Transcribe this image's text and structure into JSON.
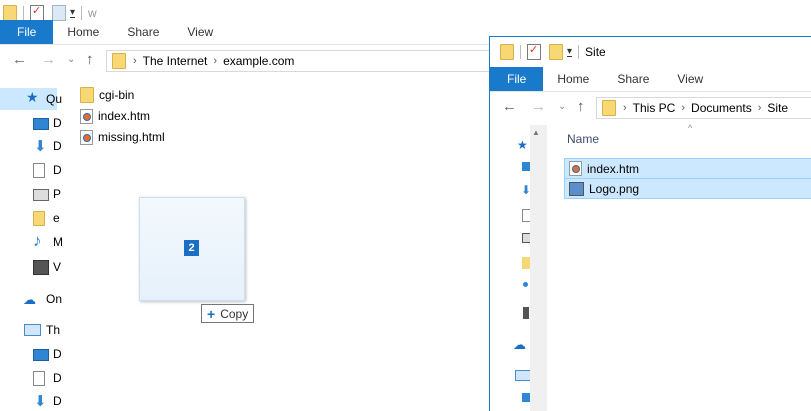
{
  "back_window": {
    "title": "w",
    "ribbon_tabs": [
      "File",
      "Home",
      "Share",
      "View"
    ],
    "address": {
      "crumbs": [
        "The Internet",
        "example.com"
      ]
    },
    "nav": [
      {
        "icon": "star-icon",
        "label": "Qu"
      },
      {
        "icon": "desktop-icon",
        "label": "D"
      },
      {
        "icon": "download-icon",
        "label": "D"
      },
      {
        "icon": "documents-icon",
        "label": "D"
      },
      {
        "icon": "pictures-icon",
        "label": "P"
      },
      {
        "icon": "folder-icon",
        "label": "e"
      },
      {
        "icon": "music-icon",
        "label": "M"
      },
      {
        "icon": "videos-icon",
        "label": "V"
      },
      {
        "icon": "onedrive-icon",
        "label": "On"
      },
      {
        "icon": "this-pc-icon",
        "label": "Th"
      },
      {
        "icon": "desktop-icon",
        "label": "D"
      },
      {
        "icon": "documents-icon",
        "label": "D"
      },
      {
        "icon": "download-icon",
        "label": "D"
      }
    ],
    "files": [
      {
        "icon": "folder-icon",
        "name": "cgi-bin"
      },
      {
        "icon": "htm-file-icon",
        "name": "index.htm"
      },
      {
        "icon": "htm-file-icon",
        "name": "missing.html"
      }
    ]
  },
  "drag": {
    "count": "2",
    "operation": "Copy"
  },
  "front_window": {
    "title": "Site",
    "ribbon_tabs": [
      "File",
      "Home",
      "Share",
      "View"
    ],
    "address": {
      "crumbs": [
        "This PC",
        "Documents",
        "Site"
      ]
    },
    "column_header": "Name",
    "files": [
      {
        "icon": "htm-file-icon",
        "name": "index.htm",
        "selected": true
      },
      {
        "icon": "png-file-icon",
        "name": "Logo.png",
        "selected": true
      }
    ]
  },
  "colors": {
    "accent": "#1979ca",
    "selection": "#cce8ff"
  }
}
